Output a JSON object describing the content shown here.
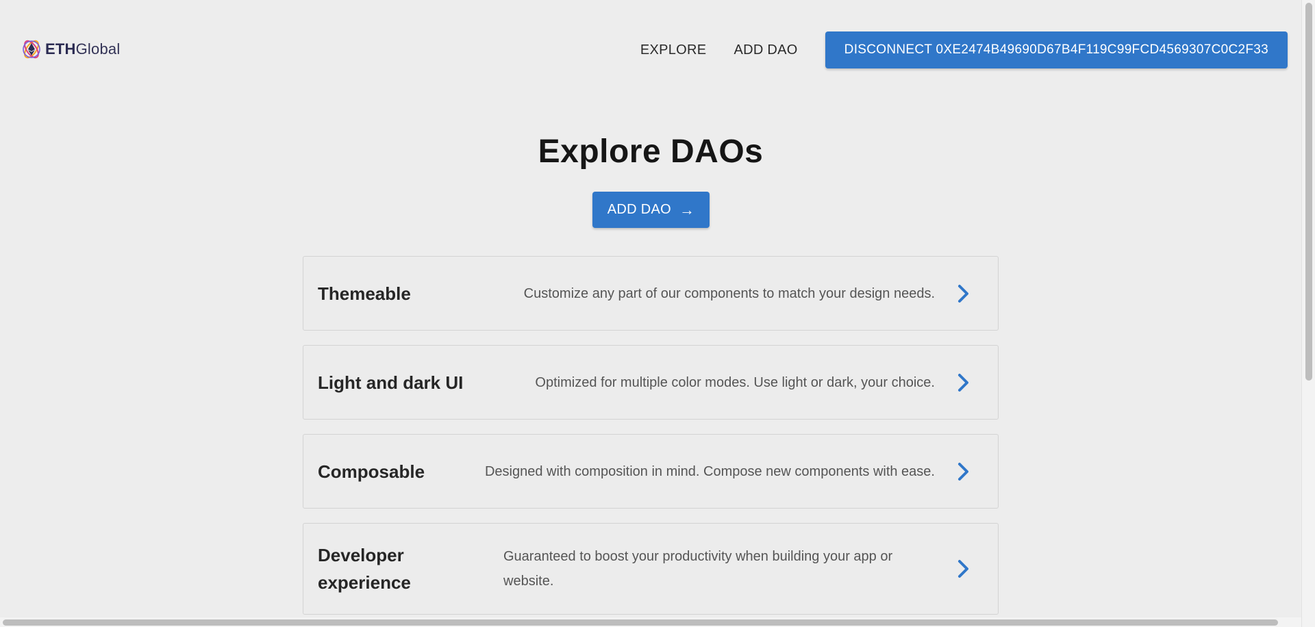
{
  "header": {
    "logo": {
      "eth": "ETH",
      "global": "Global",
      "icon": "ethglobal-logo-icon"
    },
    "nav": {
      "explore_label": "EXPLORE",
      "add_dao_label": "ADD DAO",
      "disconnect_label": "DISCONNECT 0XE2474B49690D67B4F119C99FCD4569307C0C2F33"
    }
  },
  "main": {
    "title": "Explore DAOs",
    "add_dao_button": {
      "label": "ADD DAO",
      "arrow": "→"
    },
    "cards": [
      {
        "title": "Themeable",
        "description": "Customize any part of our components to match your design needs."
      },
      {
        "title": "Light and dark UI",
        "description": "Optimized for multiple color modes. Use light or dark, your choice."
      },
      {
        "title": "Composable",
        "description": "Designed with composition in mind. Compose new components with ease."
      },
      {
        "title": "Developer experience",
        "description": "Guaranteed to boost your productivity when building your app or website."
      }
    ]
  },
  "colors": {
    "accent": "#3077c9",
    "background": "#ededed"
  },
  "icons": {
    "card_action": "chevron-right-icon"
  }
}
